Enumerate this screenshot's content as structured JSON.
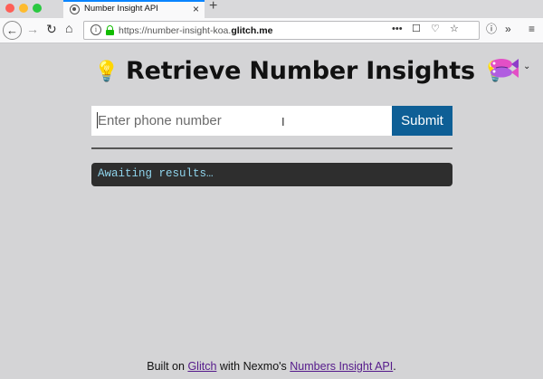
{
  "browser": {
    "tab_title": "Number Insight API",
    "tab_close": "×",
    "new_tab": "+",
    "url_prefix": "https://number-insight-koa.",
    "url_domain": "glitch.me",
    "nav": {
      "back": "←",
      "forward": "→",
      "reload": "↻",
      "home": "⌂"
    },
    "url_actions": [
      "•••",
      "☐",
      "♡",
      "☆"
    ],
    "toolbar": [
      "ⓘ",
      "»",
      "≡"
    ]
  },
  "page": {
    "title": "Retrieve Number Insights",
    "bulb_icon": "💡",
    "menu_chevron": "⌄"
  },
  "form": {
    "phone_placeholder": "Enter phone number",
    "phone_value": "",
    "submit_label": "Submit"
  },
  "results": {
    "text": "Awaiting results…"
  },
  "footer": {
    "prefix": "Built on ",
    "glitch_link": "Glitch",
    "middle": " with Nexmo's ",
    "api_link": "Numbers Insight API",
    "suffix": "."
  },
  "colors": {
    "submit_bg": "#0e5f96",
    "results_bg": "#2e2e2e",
    "results_text": "#8fd4ec",
    "page_bg": "#d4d4d6"
  }
}
